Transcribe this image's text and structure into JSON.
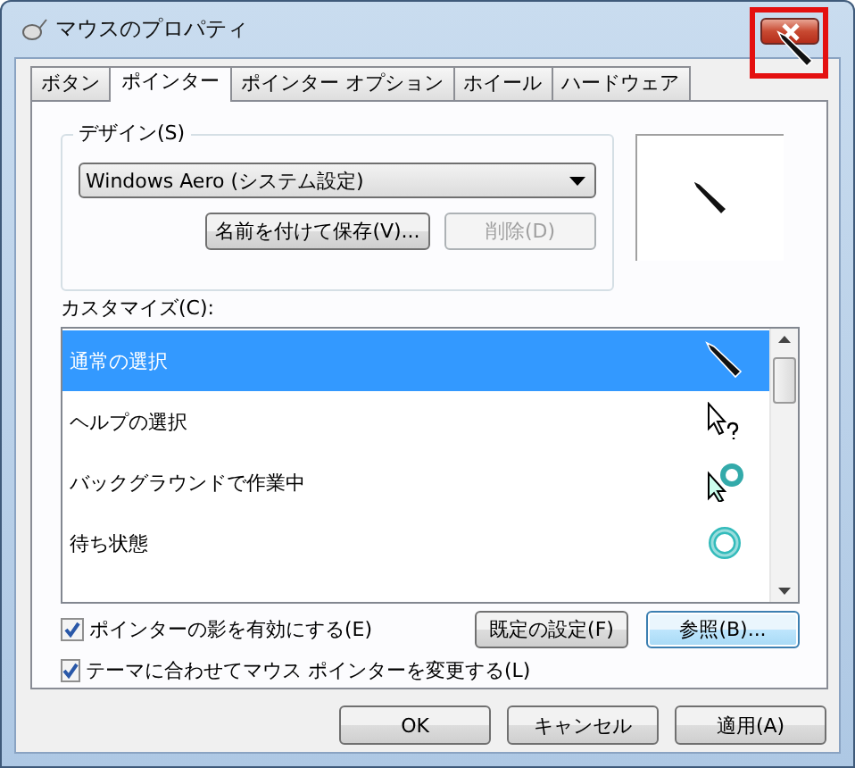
{
  "window": {
    "title": "マウスのプロパティ"
  },
  "tabs": [
    {
      "label": "ボタン",
      "selected": false
    },
    {
      "label": "ポインター",
      "selected": true
    },
    {
      "label": "ポインター オプション",
      "selected": false
    },
    {
      "label": "ホイール",
      "selected": false
    },
    {
      "label": "ハードウェア",
      "selected": false
    }
  ],
  "design": {
    "label": "デザイン(S)",
    "scheme": "Windows Aero (システム設定)",
    "buttons": [
      {
        "label": "名前を付けて保存(V)...",
        "disabled": false
      },
      {
        "label": "削除(D)",
        "disabled": true
      }
    ]
  },
  "customize": {
    "label": "カスタマイズ(C):",
    "items": [
      {
        "label": "通常の選択",
        "selected": true,
        "kind": "pen"
      },
      {
        "label": "ヘルプの選択",
        "selected": false,
        "kind": "help"
      },
      {
        "label": "バックグラウンドで作業中",
        "selected": false,
        "kind": "working"
      },
      {
        "label": "待ち状態",
        "selected": false,
        "kind": "busy"
      }
    ]
  },
  "checkboxes": [
    {
      "label": "ポインターの影を有効にする(E)",
      "checked": true
    },
    {
      "label": "テーマに合わせてマウス ポインターを変更する(L)",
      "checked": true
    }
  ],
  "side_buttons": [
    {
      "label": "既定の設定(F)",
      "focused": false
    },
    {
      "label": "参照(B)...",
      "focused": true
    }
  ],
  "footer_buttons": [
    "OK",
    "キャンセル",
    "適用(A)"
  ]
}
